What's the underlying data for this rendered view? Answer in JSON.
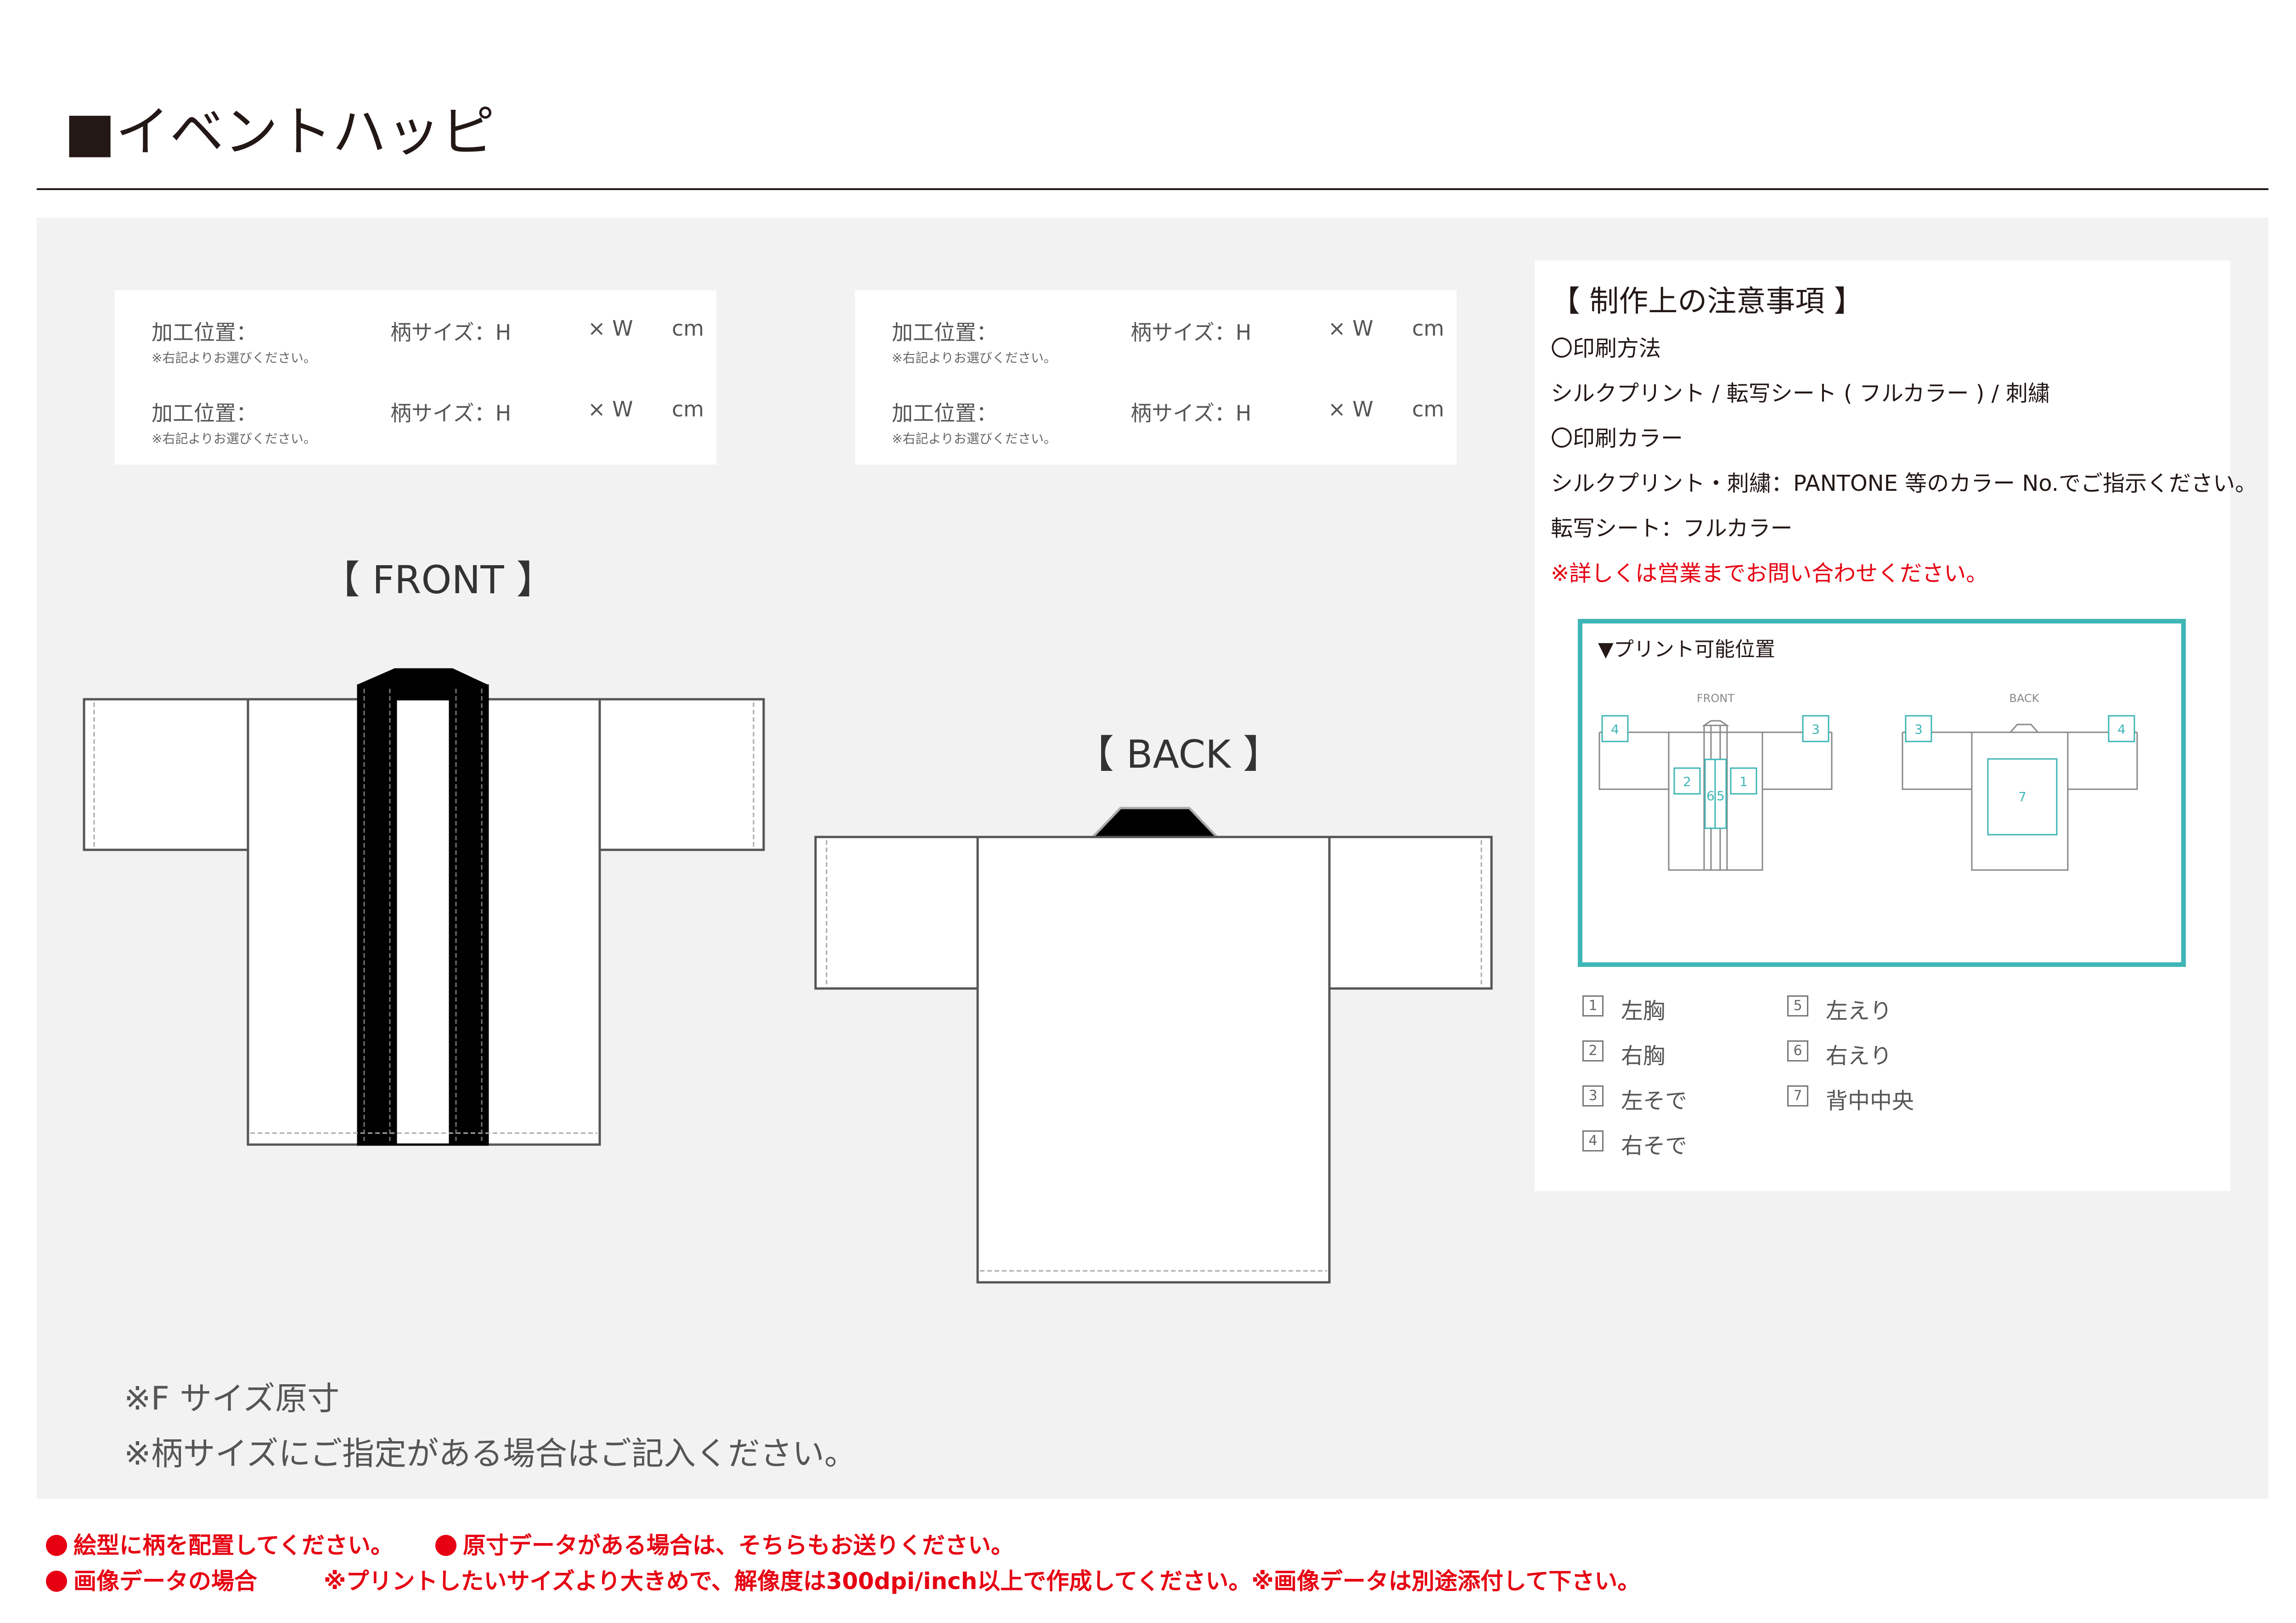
{
  "page_title": "■イベントハッピ",
  "spec_boxes": [
    {
      "rows": [
        {
          "label": "加工位置：",
          "note": "※右記よりお選びください。",
          "size": "柄サイズ：H",
          "x": "× W",
          "unit": "cm"
        },
        {
          "label": "加工位置：",
          "note": "※右記よりお選びください。",
          "size": "柄サイズ：H",
          "x": "× W",
          "unit": "cm"
        }
      ]
    },
    {
      "rows": [
        {
          "label": "加工位置：",
          "note": "※右記よりお選びください。",
          "size": "柄サイズ：H",
          "x": "× W",
          "unit": "cm"
        },
        {
          "label": "加工位置：",
          "note": "※右記よりお選びください。",
          "size": "柄サイズ：H",
          "x": "× W",
          "unit": "cm"
        }
      ]
    }
  ],
  "views": {
    "front": "【 FRONT 】",
    "back": "【 BACK 】"
  },
  "notes": {
    "title": "【 制作上の注意事項 】",
    "lines": [
      "〇印刷方法",
      "シルクプリント / 転写シート ( フルカラー ) / 刺繍",
      "〇印刷カラー",
      "シルクプリント・刺繍：PANTONE 等のカラー No.でご指示ください。",
      "転写シート：フルカラー"
    ],
    "warning": "※詳しくは営業までお問い合わせください。"
  },
  "print_positions": {
    "title": "▼プリント可能位置",
    "front_label": "FRONT",
    "back_label": "BACK",
    "front_boxes": [
      "4",
      "3",
      "2",
      "6",
      "5",
      "1"
    ],
    "back_boxes": [
      "3",
      "4",
      "7"
    ]
  },
  "legend": [
    {
      "num": "1",
      "text": "左胸"
    },
    {
      "num": "2",
      "text": "右胸"
    },
    {
      "num": "3",
      "text": "左そで"
    },
    {
      "num": "4",
      "text": "右そで"
    },
    {
      "num": "5",
      "text": "左えり"
    },
    {
      "num": "6",
      "text": "右えり"
    },
    {
      "num": "7",
      "text": "背中中央"
    }
  ],
  "size_notes": [
    "※F サイズ原寸",
    "※柄サイズにご指定がある場合はご記入ください。"
  ],
  "footer": {
    "line1a": "絵型に柄を配置してください。",
    "line1b": "原寸データがある場合は、そちらもお送りください。",
    "line2a": "画像データの場合",
    "line2b": "※プリントしたいサイズより大きめで、解像度は300dpi/inch以上で作成してください。※画像データは別途添付して下さい。"
  },
  "colors": {
    "accent": "#3fb6b6",
    "warning": "#e60012",
    "panel": "#f2f2f2",
    "collar": "#000000"
  },
  "icons": {
    "title_mark": "black-square-icon",
    "bullet": "red-dot-icon"
  }
}
